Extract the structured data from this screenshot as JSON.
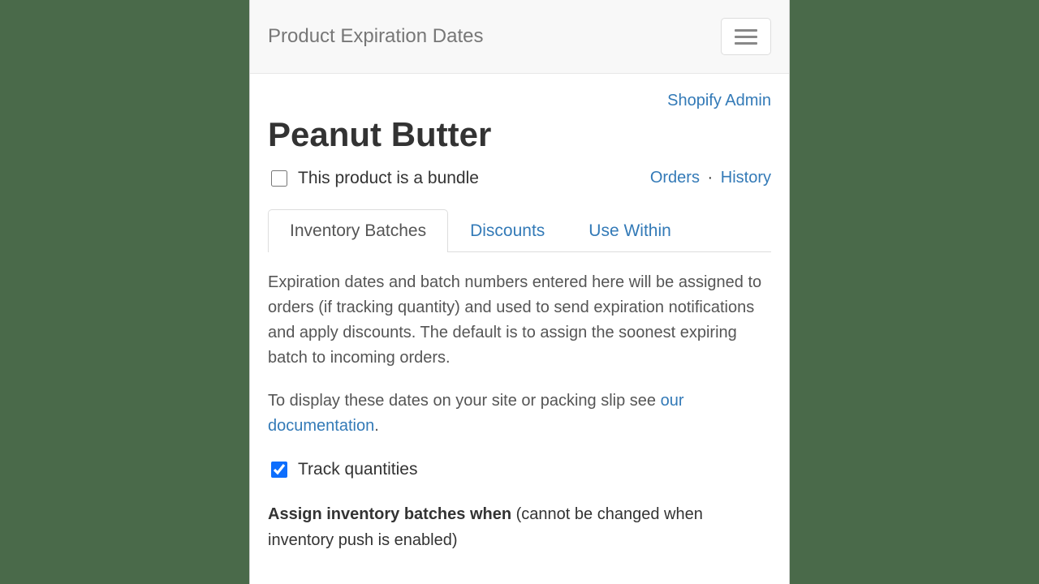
{
  "navbar": {
    "title": "Product Expiration Dates"
  },
  "links": {
    "shopify_admin": "Shopify Admin",
    "orders": "Orders",
    "history": "History",
    "separator": "·",
    "our_documentation": "our documentation"
  },
  "product": {
    "title": "Peanut Butter",
    "bundle_label": "This product is a bundle",
    "bundle_checked": false
  },
  "tabs": {
    "inventory_batches": "Inventory Batches",
    "discounts": "Discounts",
    "use_within": "Use Within"
  },
  "body": {
    "p1": "Expiration dates and batch numbers entered here will be assigned to orders (if tracking quantity) and used to send expiration notifications and apply discounts. The default is to assign the soonest expiring batch to incoming orders.",
    "p2_prefix": "To display these dates on your site or packing slip see ",
    "p2_suffix": ".",
    "track_quantities_label": "Track quantities",
    "track_quantities_checked": true,
    "assign_strong": "Assign inventory batches when",
    "assign_rest": " (cannot be changed when inventory push is enabled)"
  }
}
